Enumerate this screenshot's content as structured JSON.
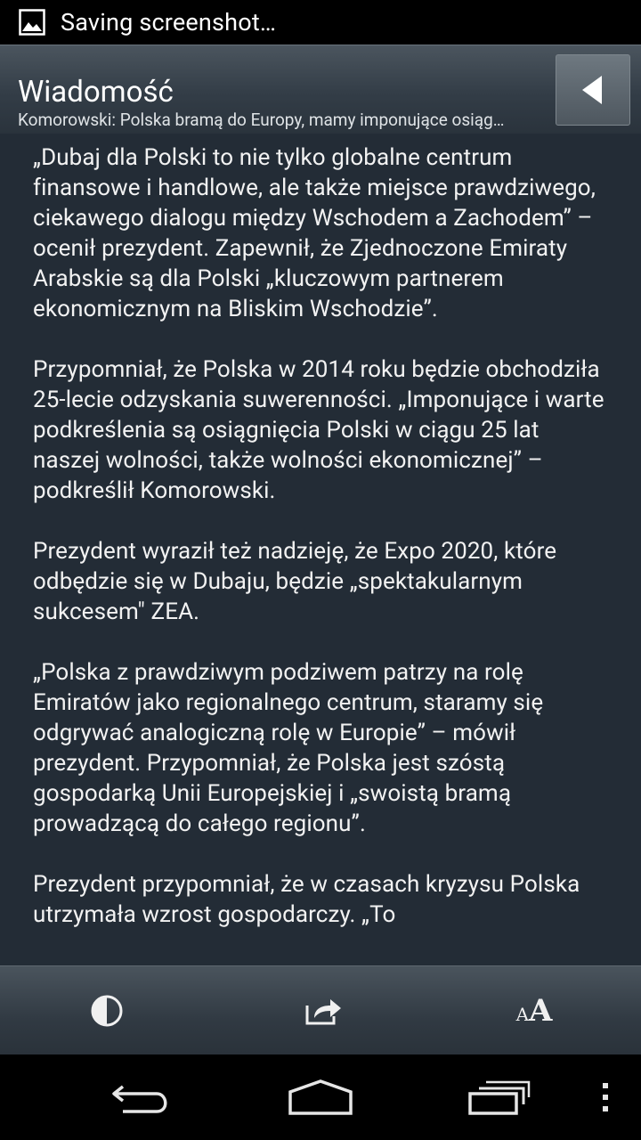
{
  "status_bar": {
    "notification_icon": "image-icon",
    "text": "Saving screenshot…"
  },
  "header": {
    "title": "Wiadomość",
    "subtitle": "Komorowski: Polska bramą do Europy, mamy imponujące osiąg…",
    "back_icon": "back-triangle-icon"
  },
  "article": {
    "paragraphs": [
      "„Dubaj dla Polski to nie tylko globalne centrum finansowe i handlowe, ale także miejsce prawdziwego, ciekawego dialogu między Wschodem a Zachodem” – ocenił prezydent. Zapewnił, że Zjednoczone Emiraty Arabskie są dla Polski „kluczowym partnerem ekonomicznym na Bliskim Wschodzie”.",
      "Przypomniał, że Polska w 2014 roku będzie obchodziła 25-lecie odzyskania suwerenności. „Imponujące i warte podkreślenia są osiągnięcia Polski w ciągu 25 lat naszej wolności, także wolności ekonomicznej” – podkreślił Komorowski.",
      "Prezydent wyraził też nadzieję, że Expo 2020, które odbędzie się w Dubaju, będzie „spektakularnym sukcesem\" ZEA.",
      "„Polska z prawdziwym podziwem patrzy na rolę Emiratów jako regionalnego centrum, staramy się odgrywać analogiczną rolę w Europie” – mówił prezydent. Przypomniał, że Polska jest szóstą gospodarką Unii Europejskiej i „swoistą bramą prowadzącą do całego regionu”.",
      "Prezydent przypomniał, że w czasach kryzysu Polska utrzymała wzrost gospodarczy. „To"
    ]
  },
  "toolbar": {
    "contrast_icon": "contrast-icon",
    "share_icon": "share-icon",
    "font_size": {
      "small": "A",
      "big": "A"
    }
  },
  "nav_bar": {
    "icons": [
      "back-icon",
      "home-icon",
      "recent-apps-icon",
      "overflow-menu-icon"
    ]
  }
}
